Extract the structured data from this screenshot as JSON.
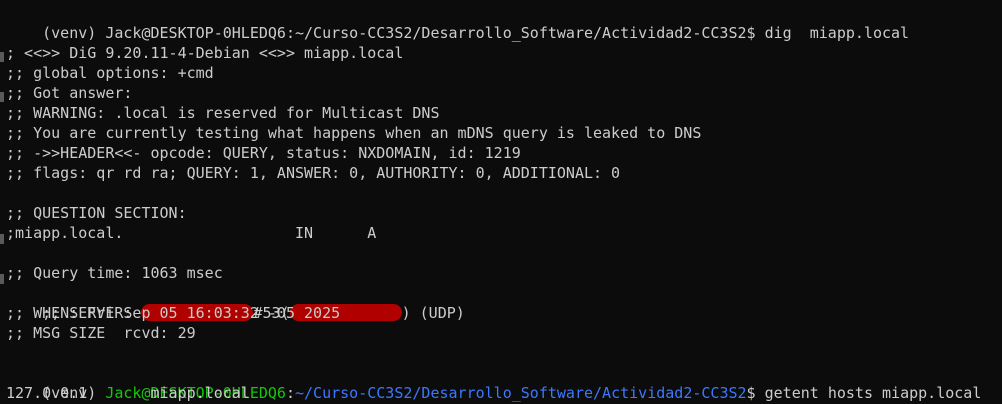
{
  "terminal": {
    "cmd1": {
      "prompt": "(venv) Jack@DESKTOP-0HLEDQ6:~/Curso-CC3S2/Desarrollo_Software/Actividad2-CC3S2$ ",
      "command": "dig  miapp.local"
    },
    "dig": {
      "banner": "; <<>> DiG 9.20.11-4-Debian <<>> miapp.local",
      "global_options": ";; global options: +cmd",
      "got_answer": ";; Got answer:",
      "warning": ";; WARNING: .local is reserved for Multicast DNS",
      "testing": ";; You are currently testing what happens when an mDNS query is leaked to DNS",
      "header": ";; ->>HEADER<<- opcode: QUERY, status: NXDOMAIN, id: 1219",
      "flags": ";; flags: qr rd ra; QUERY: 1, ANSWER: 0, AUTHORITY: 0, ADDITIONAL: 0",
      "question_section": ";; QUESTION SECTION:",
      "question": ";miapp.local.                   IN      A",
      "query_time": ";; Query time: 1063 msec",
      "server_prefix": ";; SERVER: ",
      "server_port": "#53(",
      "server_suffix": ") (UDP)",
      "when": ";; WHEN: Fri Sep 05 16:03:32 -05 2025",
      "msg_size": ";; MSG SIZE  rcvd: 29"
    },
    "cmd2": {
      "venv": "(venv) ",
      "user_host": "Jack@DESKTOP-0HLEDQ6",
      "colon": ":",
      "path": "~/Curso-CC3S2/Desarrollo_Software/Actividad2-CC3S2",
      "dollar": "$ ",
      "command": "getent hosts miapp.local"
    },
    "getent_output": "127.0.0.1       miapp.local"
  },
  "colors": {
    "background": "#0c0c0c",
    "text": "#cccccc",
    "user_host": "#16c60c",
    "path": "#3b78ff",
    "redaction": "#b00000"
  }
}
